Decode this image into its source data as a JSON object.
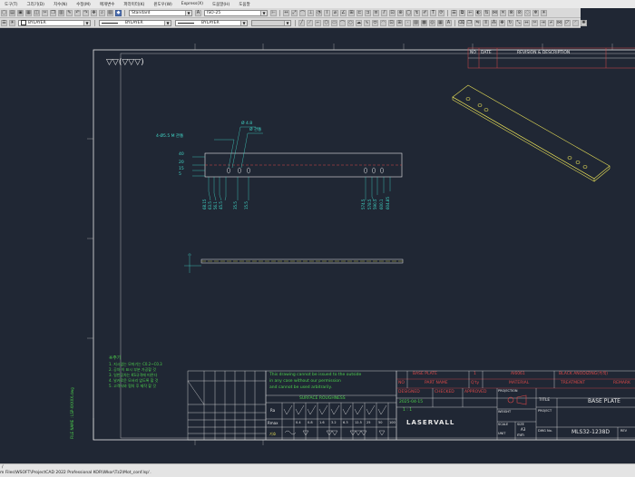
{
  "menus": [
    "도구(T)",
    "그리기(D)",
    "치수(N)",
    "수정(M)",
    "매개변수",
    "파라미터(K)",
    "윈도우(W)",
    "Express(X)",
    "도움말(H)",
    "도움말"
  ],
  "toolbar": {
    "text_style": "Standard",
    "dim_style": "ISO-25",
    "layer_color": "BYLAYER",
    "linetype": "BYLAYER",
    "lineweight": "BYLAYER"
  },
  "title_block_top": {
    "col_no": "NO",
    "col_date": "DATE",
    "col_desc": "REVISION & DESCRIPTION"
  },
  "drawing": {
    "symbol": "▽▽(▽▽▽)",
    "hole_callout": "4-Ø5.5 M 관통",
    "dim_phi_a": "Ø 4.8",
    "dim_phi_b": "Ø 관통",
    "left_dims": [
      "40",
      "20",
      "15",
      "5"
    ],
    "notes_title": "※주기",
    "notes": [
      "1. 지시없는 모따기는 C0.2~C0.3",
      "2. 공차 이 표시 부분 가공할 것",
      "3. 일반공차는 KS규격에 따른다",
      "4. 날카로운 모서리 없도록 할 것",
      "5. 고객사와 협의 후 제작 할 것"
    ],
    "side_text": "FILE NAME : LSP-XXXXX.dwg"
  },
  "surface_box": {
    "lines": [
      "This drawing cannot be issued to the outside",
      "in any case without our permission",
      "and cannot be used arbitrarily."
    ],
    "title": "SURFACE ROUGHNESS",
    "row_label_a": "Ra",
    "row_label_b": "Rmax",
    "row_label_c": "기호",
    "ra_values": [
      "",
      "0.1",
      "0.2",
      "0.4",
      "0.8",
      "1.6",
      "3.2",
      "6.3",
      "12.5",
      "25"
    ],
    "rmax_values": [
      "",
      "0.4",
      "0.8",
      "1.6",
      "3.2",
      "6.3",
      "12.5",
      "25",
      "50",
      "100"
    ]
  },
  "title_block": {
    "part_name_value": "BASE PLATE",
    "qty_value": "1",
    "material_value": "Al6061",
    "treatment_value": "BLACK ANODIZING(흑색)",
    "h_no": "NO",
    "h_part_name": "PART NAME",
    "h_qty": "Q'ty",
    "h_material": "MATERIAL",
    "h_treatment": "TREATMENT",
    "h_remark": "REMARK",
    "h_designed": "DESIGNED",
    "h_checked": "CHECKED",
    "h_approved": "APPROVED",
    "h_projection": "PROJECTION",
    "h_title": "TITLE",
    "title_value": "BASE PLATE",
    "date_value": "2025-04-15",
    "scale_value": "1 : 1",
    "h_weight": "WEIGHT",
    "h_project": "PROJECT",
    "h_scale": "SCALE",
    "h_size": "SIZE",
    "size_value": "A3",
    "h_unit": "UNIT",
    "unit_value": "mm",
    "h_dwg_no": "DWG No.",
    "dwg_no_value": "MLS32-1238D",
    "h_rev": "REV",
    "company": "LASERVALL"
  },
  "hole_labels_left": [
    "68.15",
    "63.5",
    "56.1",
    "45.5",
    "35.5",
    "15.5"
  ],
  "hole_labels_right": [
    "574.5",
    "578.5",
    "590.5",
    "600.1",
    "604.85"
  ],
  "statusbar": {
    "line1": "/",
    "line2": "m Files\\WSOFT\\ProjectCAD 2022 Professional KOR\\Wkor\\Tz2\\Mot_conf.lsp'."
  },
  "colors": {
    "canvas": "#202734",
    "line_green": "#4ccf4c",
    "line_cyan": "#41d7c8",
    "line_yellow": "#e6de57",
    "line_red": "#d94848",
    "frame": "#e8e8e8"
  }
}
